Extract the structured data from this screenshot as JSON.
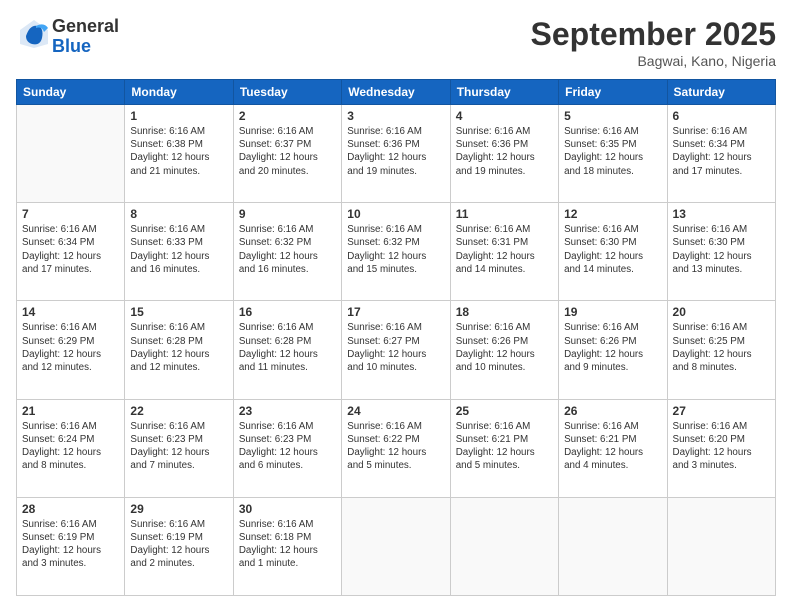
{
  "logo": {
    "general": "General",
    "blue": "Blue"
  },
  "header": {
    "month": "September 2025",
    "location": "Bagwai, Kano, Nigeria"
  },
  "weekdays": [
    "Sunday",
    "Monday",
    "Tuesday",
    "Wednesday",
    "Thursday",
    "Friday",
    "Saturday"
  ],
  "weeks": [
    [
      {
        "day": "",
        "info": ""
      },
      {
        "day": "1",
        "info": "Sunrise: 6:16 AM\nSunset: 6:38 PM\nDaylight: 12 hours\nand 21 minutes."
      },
      {
        "day": "2",
        "info": "Sunrise: 6:16 AM\nSunset: 6:37 PM\nDaylight: 12 hours\nand 20 minutes."
      },
      {
        "day": "3",
        "info": "Sunrise: 6:16 AM\nSunset: 6:36 PM\nDaylight: 12 hours\nand 19 minutes."
      },
      {
        "day": "4",
        "info": "Sunrise: 6:16 AM\nSunset: 6:36 PM\nDaylight: 12 hours\nand 19 minutes."
      },
      {
        "day": "5",
        "info": "Sunrise: 6:16 AM\nSunset: 6:35 PM\nDaylight: 12 hours\nand 18 minutes."
      },
      {
        "day": "6",
        "info": "Sunrise: 6:16 AM\nSunset: 6:34 PM\nDaylight: 12 hours\nand 17 minutes."
      }
    ],
    [
      {
        "day": "7",
        "info": "Sunrise: 6:16 AM\nSunset: 6:34 PM\nDaylight: 12 hours\nand 17 minutes."
      },
      {
        "day": "8",
        "info": "Sunrise: 6:16 AM\nSunset: 6:33 PM\nDaylight: 12 hours\nand 16 minutes."
      },
      {
        "day": "9",
        "info": "Sunrise: 6:16 AM\nSunset: 6:32 PM\nDaylight: 12 hours\nand 16 minutes."
      },
      {
        "day": "10",
        "info": "Sunrise: 6:16 AM\nSunset: 6:32 PM\nDaylight: 12 hours\nand 15 minutes."
      },
      {
        "day": "11",
        "info": "Sunrise: 6:16 AM\nSunset: 6:31 PM\nDaylight: 12 hours\nand 14 minutes."
      },
      {
        "day": "12",
        "info": "Sunrise: 6:16 AM\nSunset: 6:30 PM\nDaylight: 12 hours\nand 14 minutes."
      },
      {
        "day": "13",
        "info": "Sunrise: 6:16 AM\nSunset: 6:30 PM\nDaylight: 12 hours\nand 13 minutes."
      }
    ],
    [
      {
        "day": "14",
        "info": "Sunrise: 6:16 AM\nSunset: 6:29 PM\nDaylight: 12 hours\nand 12 minutes."
      },
      {
        "day": "15",
        "info": "Sunrise: 6:16 AM\nSunset: 6:28 PM\nDaylight: 12 hours\nand 12 minutes."
      },
      {
        "day": "16",
        "info": "Sunrise: 6:16 AM\nSunset: 6:28 PM\nDaylight: 12 hours\nand 11 minutes."
      },
      {
        "day": "17",
        "info": "Sunrise: 6:16 AM\nSunset: 6:27 PM\nDaylight: 12 hours\nand 10 minutes."
      },
      {
        "day": "18",
        "info": "Sunrise: 6:16 AM\nSunset: 6:26 PM\nDaylight: 12 hours\nand 10 minutes."
      },
      {
        "day": "19",
        "info": "Sunrise: 6:16 AM\nSunset: 6:26 PM\nDaylight: 12 hours\nand 9 minutes."
      },
      {
        "day": "20",
        "info": "Sunrise: 6:16 AM\nSunset: 6:25 PM\nDaylight: 12 hours\nand 8 minutes."
      }
    ],
    [
      {
        "day": "21",
        "info": "Sunrise: 6:16 AM\nSunset: 6:24 PM\nDaylight: 12 hours\nand 8 minutes."
      },
      {
        "day": "22",
        "info": "Sunrise: 6:16 AM\nSunset: 6:23 PM\nDaylight: 12 hours\nand 7 minutes."
      },
      {
        "day": "23",
        "info": "Sunrise: 6:16 AM\nSunset: 6:23 PM\nDaylight: 12 hours\nand 6 minutes."
      },
      {
        "day": "24",
        "info": "Sunrise: 6:16 AM\nSunset: 6:22 PM\nDaylight: 12 hours\nand 5 minutes."
      },
      {
        "day": "25",
        "info": "Sunrise: 6:16 AM\nSunset: 6:21 PM\nDaylight: 12 hours\nand 5 minutes."
      },
      {
        "day": "26",
        "info": "Sunrise: 6:16 AM\nSunset: 6:21 PM\nDaylight: 12 hours\nand 4 minutes."
      },
      {
        "day": "27",
        "info": "Sunrise: 6:16 AM\nSunset: 6:20 PM\nDaylight: 12 hours\nand 3 minutes."
      }
    ],
    [
      {
        "day": "28",
        "info": "Sunrise: 6:16 AM\nSunset: 6:19 PM\nDaylight: 12 hours\nand 3 minutes."
      },
      {
        "day": "29",
        "info": "Sunrise: 6:16 AM\nSunset: 6:19 PM\nDaylight: 12 hours\nand 2 minutes."
      },
      {
        "day": "30",
        "info": "Sunrise: 6:16 AM\nSunset: 6:18 PM\nDaylight: 12 hours\nand 1 minute."
      },
      {
        "day": "",
        "info": ""
      },
      {
        "day": "",
        "info": ""
      },
      {
        "day": "",
        "info": ""
      },
      {
        "day": "",
        "info": ""
      }
    ]
  ]
}
